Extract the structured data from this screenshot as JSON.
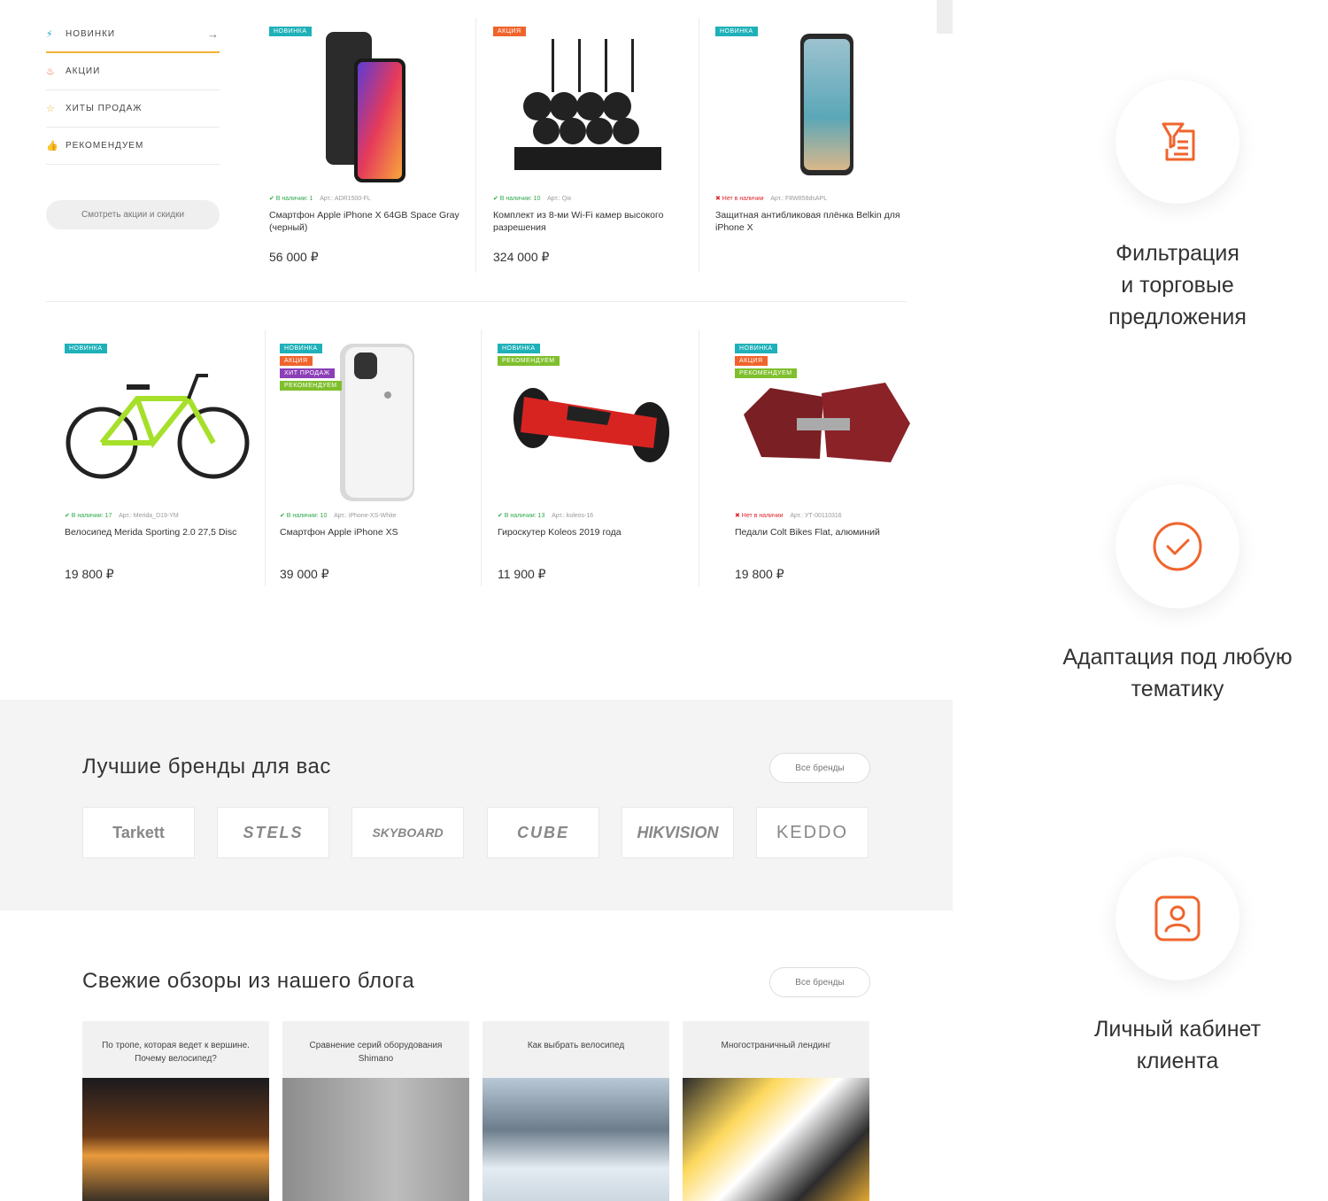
{
  "sidebar": {
    "items": [
      {
        "label": "НОВИНКИ",
        "icon": "lightning-icon"
      },
      {
        "label": "АКЦИИ",
        "icon": "fire-icon"
      },
      {
        "label": "ХИТЫ ПРОДАЖ",
        "icon": "star-icon"
      },
      {
        "label": "РЕКОМЕНДУЕМ",
        "icon": "thumbs-up-icon"
      }
    ],
    "button": "Смотреть акции и скидки"
  },
  "products": [
    {
      "badges": [
        "НОВИНКА"
      ],
      "stock": "✔ В наличии:",
      "stock_count": "1",
      "sku": "Арт.: ADR1500-FL",
      "name": "Смартфон Apple iPhone X 64GB Space Gray (черный)",
      "price": "56 000 ₽"
    },
    {
      "badges": [
        "АКЦИЯ"
      ],
      "stock": "✔ В наличии:",
      "stock_count": "10",
      "sku": "Арт.: Qix",
      "name": "Комплект из 8-ми Wi-Fi камер высокого разрешения",
      "price": "324 000 ₽"
    },
    {
      "badges": [
        "НОВИНКА"
      ],
      "stock": "✖ Нет в наличии",
      "stock_count": "",
      "sku": "Арт.: F8W858dsAPL",
      "name": "Защитная антибликовая плёнка Belkin для iPhone X",
      "price": ""
    },
    {
      "badges": [
        "НОВИНКА"
      ],
      "stock": "✔ В наличии:",
      "stock_count": "17",
      "sku": "Арт.: Merida_D19-YM",
      "name": "Велосипед Merida Sporting 2.0 27,5 Disc",
      "price": "19 800 ₽"
    },
    {
      "badges": [
        "НОВИНКА",
        "АКЦИЯ",
        "ХИТ ПРОДАЖ",
        "РЕКОМЕНДУЕМ"
      ],
      "stock": "✔ В наличии:",
      "stock_count": "10",
      "sku": "Арт.: iPhone-XS-White",
      "name": "Смартфон Apple iPhone XS",
      "price": "39 000 ₽"
    },
    {
      "badges": [
        "НОВИНКА",
        "РЕКОМЕНДУЕМ"
      ],
      "stock": "✔ В наличии:",
      "stock_count": "13",
      "sku": "Арт.: koleos-16",
      "name": "Гироскутер Koleos 2019 года",
      "price": "11 900 ₽"
    },
    {
      "badges": [
        "НОВИНКА",
        "АКЦИЯ",
        "РЕКОМЕНДУЕМ"
      ],
      "stock": "✖ Нет в наличии",
      "stock_count": "",
      "sku": "Арт.: УТ-00110316",
      "name": "Педали Colt Bikes Flat, алюминий",
      "price": "19 800 ₽"
    }
  ],
  "badge_colors": {
    "НОВИНКА": "#1fb1b9",
    "АКЦИЯ": "#f0642c",
    "ХИТ ПРОДАЖ": "#8c3fb7",
    "РЕКОМЕНДУЕМ": "#7fbf2c"
  },
  "brands_section": {
    "title": "Лучшие бренды для вас",
    "all_button": "Все бренды",
    "brands": [
      "Tarkett",
      "STELS",
      "SKYBOARD",
      "CUBE",
      "HIKVISION",
      "KEDDO"
    ]
  },
  "blog_section": {
    "title": "Свежие обзоры из нашего блога",
    "all_button": "Все бренды",
    "posts": [
      "По тропе, которая ведет к вершине. Почему велосипед?",
      "Сравнение серий оборудования Shimano",
      "Как выбрать велосипед",
      "Многостраничный лендинг"
    ]
  },
  "features": [
    {
      "icon": "filter-document-icon",
      "line1": "Фильтрация",
      "line2": "и торговые",
      "line3": "предложения"
    },
    {
      "icon": "checkmark-circle-icon",
      "line1": "Адаптация под любую",
      "line2": "тематику",
      "line3": ""
    },
    {
      "icon": "user-profile-icon",
      "line1": "Личный кабинет",
      "line2": "клиента",
      "line3": ""
    }
  ],
  "accent_color": "#f0642c"
}
